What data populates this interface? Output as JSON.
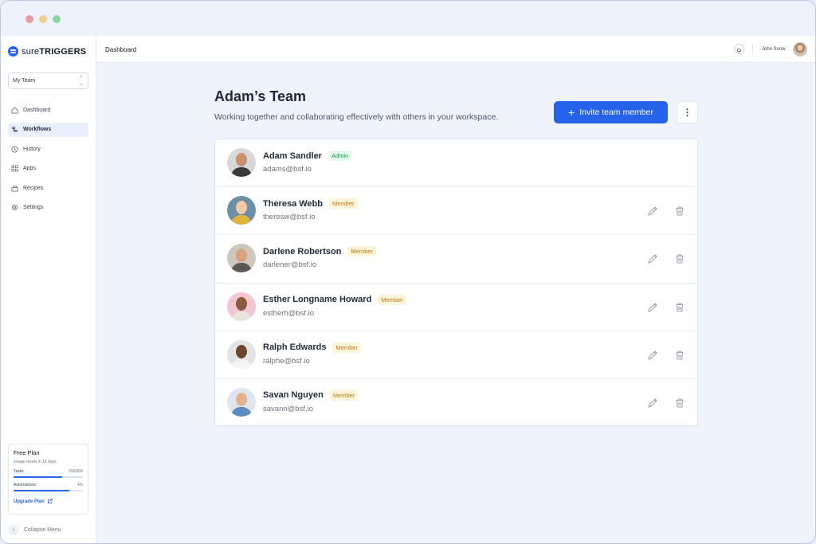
{
  "brand": {
    "name_part1": "sure",
    "name_part2": "TRIGGERS"
  },
  "team_select": {
    "value": "My Team"
  },
  "nav": [
    {
      "label": "Dashboard",
      "icon": "home-icon"
    },
    {
      "label": "Workflows",
      "icon": "workflow-icon",
      "active": true
    },
    {
      "label": "History",
      "icon": "history-icon"
    },
    {
      "label": "Apps",
      "icon": "apps-icon"
    },
    {
      "label": "Recipes",
      "icon": "recipes-icon"
    },
    {
      "label": "Settings",
      "icon": "settings-icon"
    }
  ],
  "plan": {
    "title": "Free Plan",
    "subtitle": "Usage resets in 18 days.",
    "tasks_label": "Tasks",
    "tasks_value": "350/500",
    "tasks_fraction": 0.7,
    "automations_label": "Automations:",
    "automations_value": "4/5",
    "automations_fraction": 0.8,
    "upgrade_label": "Upgrade Plan"
  },
  "collapse_label": "Collapse Menu",
  "header": {
    "breadcrumb": "Dashboard",
    "user_name": "John Snow"
  },
  "team": {
    "title": "Adam’s Team",
    "subtitle": "Working together and collaborating effectively with others in your workspace.",
    "invite_label": "Invite team member",
    "kebab": "⋮"
  },
  "members": [
    {
      "name": "Adam Sandler",
      "role": "Admin",
      "email": "adams@bsf.io",
      "skin": "#c9926d",
      "bg": "#d8d8d8",
      "shirt": "#3a3a3a"
    },
    {
      "name": "Theresa Webb",
      "role": "Member",
      "email": "theresw@bsf.io",
      "skin": "#f0c9a8",
      "bg": "#6a8fa7",
      "shirt": "#e1b43c"
    },
    {
      "name": "Darlene Robertson",
      "role": "Member",
      "email": "darlener@bsf.io",
      "skin": "#d9a27c",
      "bg": "#cfc7bd",
      "shirt": "#5e5853"
    },
    {
      "name": "Esther Longname Howard",
      "role": "Member",
      "email": "estherh@bsf.io",
      "skin": "#8a5a3c",
      "bg": "#f3c6d3",
      "shirt": "#e9e4de"
    },
    {
      "name": "Ralph Edwards",
      "role": "Member",
      "email": "ralphe@bsf.io",
      "skin": "#6e4630",
      "bg": "#e4e4e4",
      "shirt": "#f4f4f4"
    },
    {
      "name": "Savan Nguyen",
      "role": "Member",
      "email": "savann@bsf.io",
      "skin": "#e3b28e",
      "bg": "#dfe6ee",
      "shirt": "#5b8cc0"
    }
  ]
}
